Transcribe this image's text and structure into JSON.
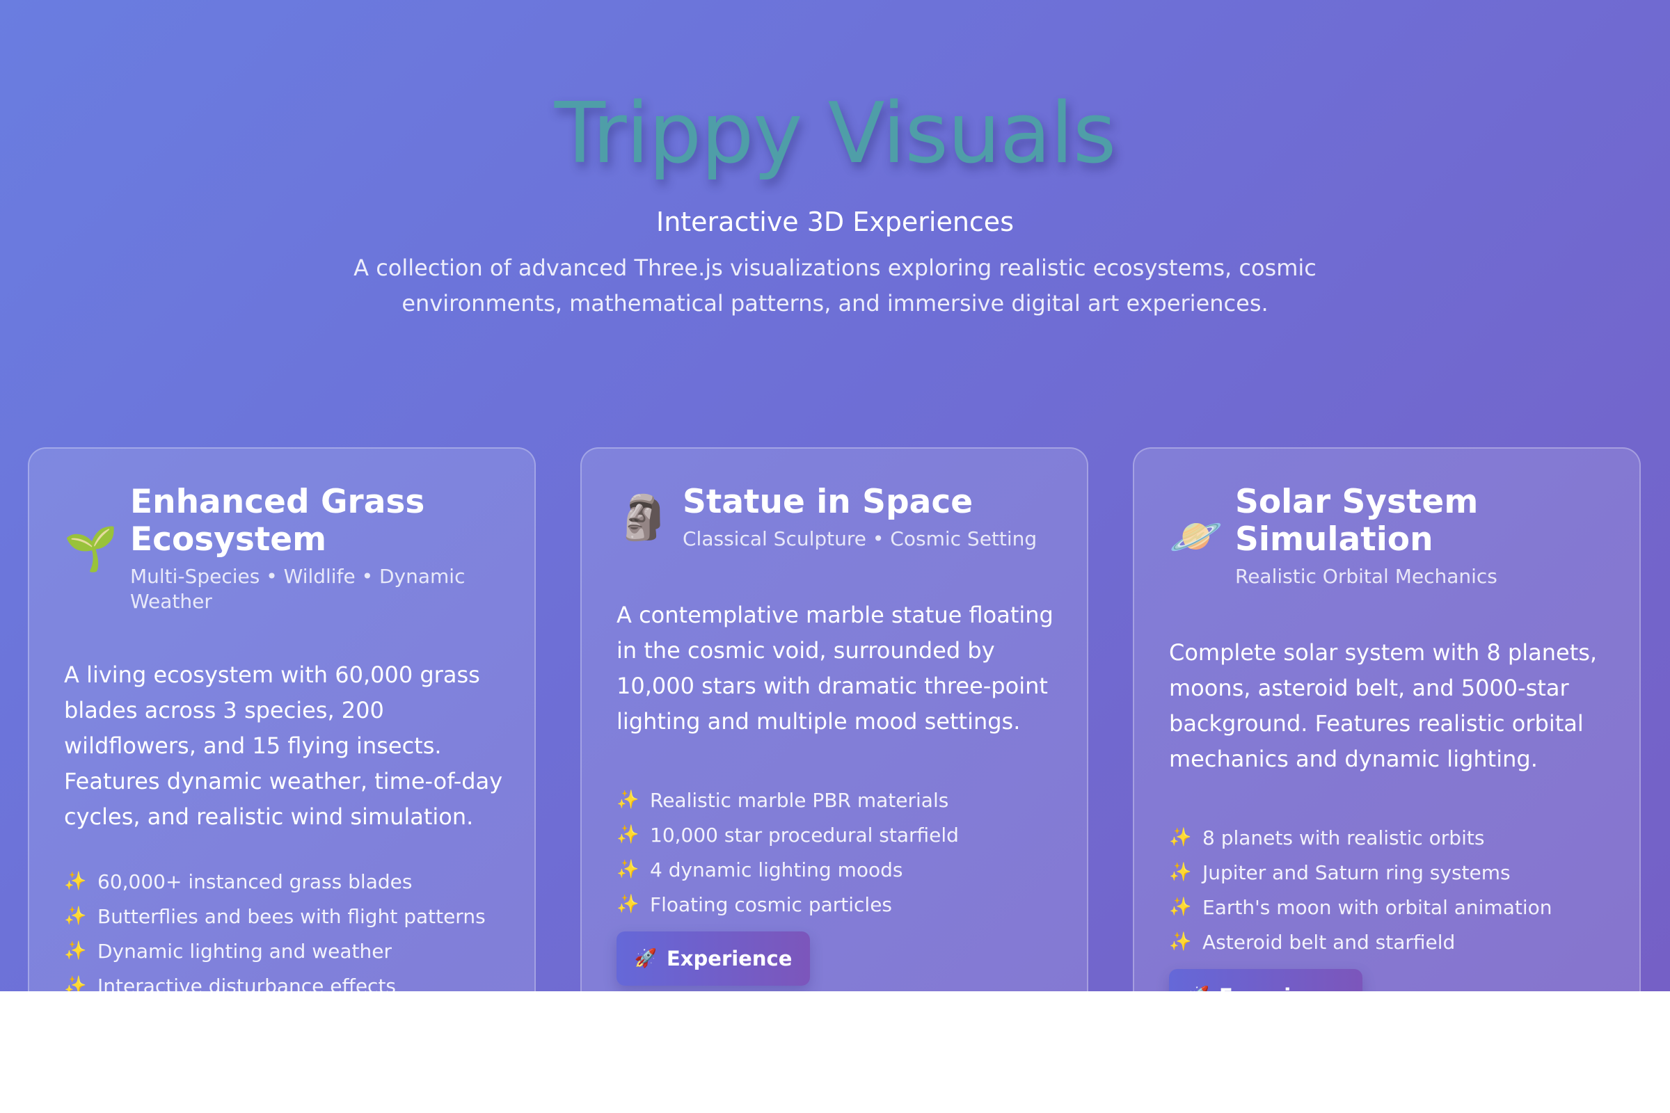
{
  "hero": {
    "title": "Trippy Visuals",
    "subtitle": "Interactive 3D Experiences",
    "description": "A collection of advanced Three.js visualizations exploring realistic ecosystems, cosmic environments, mathematical patterns, and immersive digital art experiences."
  },
  "cards": [
    {
      "icon": "seedling-icon",
      "emoji": "🌱",
      "title": "Enhanced Grass Ecosystem",
      "meta": "Multi-Species • Wildlife • Dynamic Weather",
      "description": "A living ecosystem with 60,000 grass blades across 3 species, 200 wildflowers, and 15 flying insects. Features dynamic weather, time-of-day cycles, and realistic wind simulation.",
      "features": [
        "60,000+ instanced grass blades",
        "Butterflies and bees with flight patterns",
        "Dynamic lighting and weather",
        "Interactive disturbance effects"
      ],
      "feature_icon": "sparkles-icon",
      "feature_glyph": "✨"
    },
    {
      "icon": "moai-statue-icon",
      "emoji": "🗿",
      "title": "Statue in Space",
      "meta": "Classical Sculpture • Cosmic Setting",
      "description": "A contemplative marble statue floating in the cosmic void, surrounded by 10,000 stars with dramatic three-point lighting and multiple mood settings.",
      "features": [
        "Realistic marble PBR materials",
        "10,000 star procedural starfield",
        "4 dynamic lighting moods",
        "Floating cosmic particles"
      ],
      "feature_icon": "sparkles-icon",
      "feature_glyph": "✨",
      "button_label": "Experience",
      "button_icon": "rocket-icon",
      "button_glyph": "🚀"
    },
    {
      "icon": "ringed-planet-icon",
      "emoji": "🪐",
      "title": "Solar System Simulation",
      "meta": "Realistic Orbital Mechanics",
      "description": "Complete solar system with 8 planets, moons, asteroid belt, and 5000-star background. Features realistic orbital mechanics and dynamic lighting.",
      "features": [
        "8 planets with realistic orbits",
        "Jupiter and Saturn ring systems",
        "Earth's moon with orbital animation",
        "Asteroid belt and starfield"
      ],
      "feature_icon": "sparkles-icon",
      "feature_glyph": "✨",
      "button_label": "Experience",
      "button_icon": "rocket-icon",
      "button_glyph": "🚀"
    }
  ],
  "colors": {
    "background_start": "#6a7de0",
    "background_end": "#7560c6",
    "title_teal": "#4f9ea8",
    "button_start": "#6568d8",
    "button_end": "#7c56bb",
    "sparkle": "#f2d35c"
  }
}
